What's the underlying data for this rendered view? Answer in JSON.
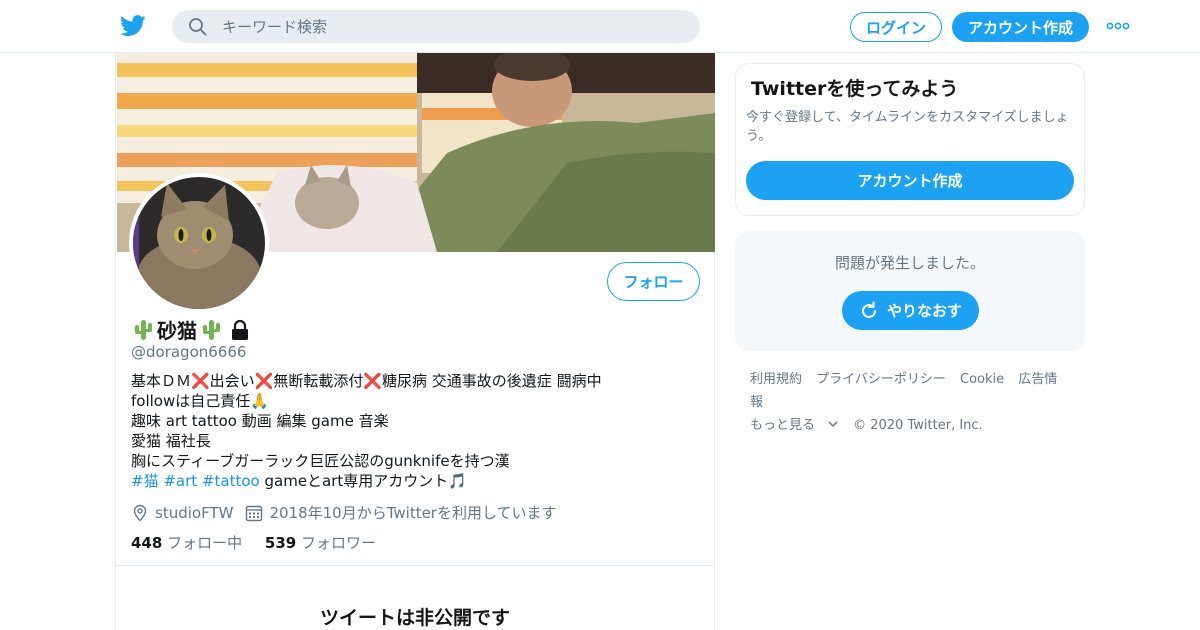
{
  "header": {
    "search_placeholder": "キーワード検索",
    "login_label": "ログイン",
    "signup_label": "アカウント作成"
  },
  "profile": {
    "follow_label": "フォロー",
    "display_name": "砂猫",
    "handle": "@doragon6666",
    "bio": {
      "line1": "基本ＤＭ❌出会い❌無断転載添付❌糖尿病 交通事故の後遺症 闘病中",
      "line2": "followは自己責任🙏",
      "line3": "趣味 art tattoo 動画 編集 game 音楽",
      "line4": "愛猫 福社長",
      "line5": "胸にスティーブガーラック巨匠公認のgunknifeを持つ漢",
      "hashtags": [
        "#猫",
        "#art",
        "#tattoo"
      ],
      "line6_tail": "gameとart専用アカウント🎵"
    },
    "location": "studioFTW",
    "joined": "2018年10月からTwitterを利用しています",
    "following_count": "448",
    "following_label": "フォロー中",
    "followers_count": "539",
    "followers_label": "フォロワー",
    "protected_message": "ツイートは非公開です"
  },
  "sidebar": {
    "promo_title": "Twitterを使ってみよう",
    "promo_text": "今すぐ登録して、タイムラインをカスタマイズしましょう。",
    "promo_button": "アカウント作成",
    "error_text": "問題が発生しました。",
    "retry_label": "やりなおす"
  },
  "footer": {
    "links": [
      "利用規約",
      "プライバシーポリシー",
      "Cookie",
      "広告情報"
    ],
    "more": "もっと見る",
    "copyright": "© 2020 Twitter, Inc."
  },
  "colors": {
    "brand": "#1da1f2",
    "secondary_text": "#657786",
    "link": "#1b95e0"
  }
}
